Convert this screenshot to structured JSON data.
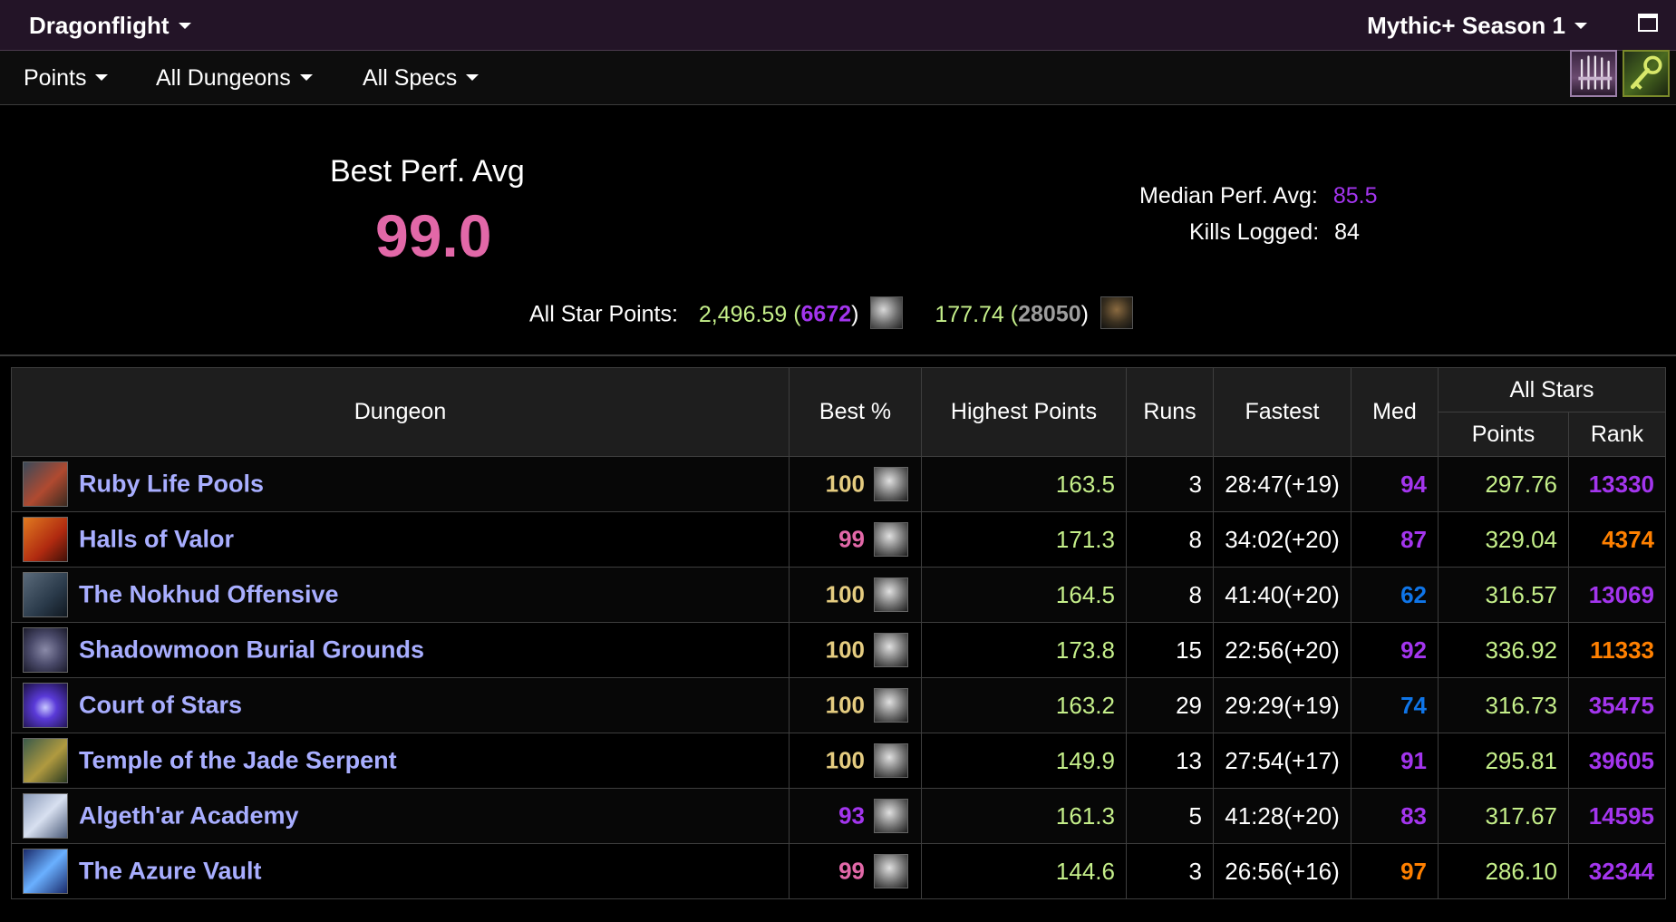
{
  "title_bar": {
    "expansion": "Dragonflight",
    "season": "Mythic+ Season 1"
  },
  "filters": [
    {
      "label": "Points"
    },
    {
      "label": "All Dungeons"
    },
    {
      "label": "All Specs"
    }
  ],
  "top_icons": [
    "weapons-icon",
    "key-icon"
  ],
  "summary": {
    "best_label": "Best Perf. Avg",
    "best_value": "99.0",
    "median_label": "Median Perf. Avg:",
    "median_value": "85.5",
    "kills_label": "Kills Logged:",
    "kills_value": "84",
    "allstars_label": "All Star Points:",
    "allstars_1_points": "2,496.59",
    "allstars_1_rank": "6672",
    "allstars_2_points": "177.74",
    "allstars_2_rank": "28050"
  },
  "colors": {
    "pink": "#e268a8",
    "gold": "#e5cc80",
    "purple": "#a335ee",
    "blue": "#0f75e8",
    "orange": "#ff8000",
    "green": "#c5ef8a",
    "link": "#a8aeff"
  },
  "table": {
    "headers": {
      "dungeon": "Dungeon",
      "best": "Best %",
      "highest": "Highest Points",
      "runs": "Runs",
      "fastest": "Fastest",
      "med": "Med",
      "allstars": "All Stars",
      "points": "Points",
      "rank": "Rank"
    },
    "rows": [
      {
        "name": "Ruby Life Pools",
        "best": "100",
        "best_color": "gold",
        "highest": "163.5",
        "runs": "3",
        "fastest": "28:47(+19)",
        "med": "94",
        "med_color": "purple",
        "points": "297.76",
        "rank": "13330",
        "rank_color": "purple"
      },
      {
        "name": "Halls of Valor",
        "best": "99",
        "best_color": "pink",
        "highest": "171.3",
        "runs": "8",
        "fastest": "34:02(+20)",
        "med": "87",
        "med_color": "purple",
        "points": "329.04",
        "rank": "4374",
        "rank_color": "orange"
      },
      {
        "name": "The Nokhud Offensive",
        "best": "100",
        "best_color": "gold",
        "highest": "164.5",
        "runs": "8",
        "fastest": "41:40(+20)",
        "med": "62",
        "med_color": "blue",
        "points": "316.57",
        "rank": "13069",
        "rank_color": "purple"
      },
      {
        "name": "Shadowmoon Burial Grounds",
        "best": "100",
        "best_color": "gold",
        "highest": "173.8",
        "runs": "15",
        "fastest": "22:56(+20)",
        "med": "92",
        "med_color": "purple",
        "points": "336.92",
        "rank": "11333",
        "rank_color": "orange"
      },
      {
        "name": "Court of Stars",
        "best": "100",
        "best_color": "gold",
        "highest": "163.2",
        "runs": "29",
        "fastest": "29:29(+19)",
        "med": "74",
        "med_color": "blue",
        "points": "316.73",
        "rank": "35475",
        "rank_color": "purple"
      },
      {
        "name": "Temple of the Jade Serpent",
        "best": "100",
        "best_color": "gold",
        "highest": "149.9",
        "runs": "13",
        "fastest": "27:54(+17)",
        "med": "91",
        "med_color": "purple",
        "points": "295.81",
        "rank": "39605",
        "rank_color": "purple"
      },
      {
        "name": "Algeth'ar Academy",
        "best": "93",
        "best_color": "purple",
        "highest": "161.3",
        "runs": "5",
        "fastest": "41:28(+20)",
        "med": "83",
        "med_color": "purple",
        "points": "317.67",
        "rank": "14595",
        "rank_color": "purple"
      },
      {
        "name": "The Azure Vault",
        "best": "99",
        "best_color": "pink",
        "highest": "144.6",
        "runs": "3",
        "fastest": "26:56(+16)",
        "med": "97",
        "med_color": "orange",
        "points": "286.10",
        "rank": "32344",
        "rank_color": "purple"
      }
    ]
  }
}
